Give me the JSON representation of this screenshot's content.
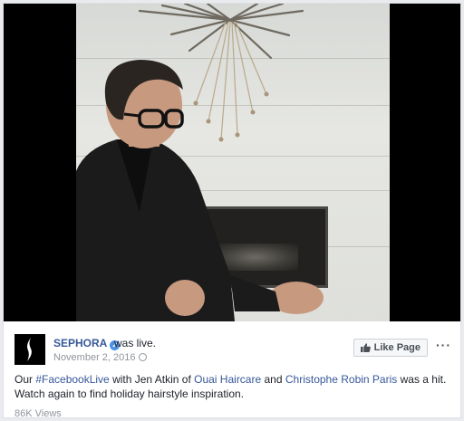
{
  "post": {
    "page_name": "SEPHORA",
    "status": "was live.",
    "date": "November 2, 2016",
    "like_button_label": "Like Page",
    "more_label": "···",
    "text": {
      "intro": "Our ",
      "hashtag": "#FacebookLive",
      "middle1": " with Jen Atkin of ",
      "link1": "Ouai Haircare",
      "middle2": " and ",
      "link2": "Christophe Robin Paris",
      "end": " was a hit. Watch again to find holiday hairstyle inspiration."
    },
    "views": "86K Views"
  },
  "icons": {
    "avatar": "sephora-logo",
    "verified": "verified-badge-icon",
    "privacy": "globe-icon",
    "like": "thumbs-up-icon",
    "more": "more-options-icon"
  },
  "colors": {
    "link": "#365899",
    "verified": "#4a90e2",
    "text": "#1d2129",
    "meta": "#90949c"
  }
}
